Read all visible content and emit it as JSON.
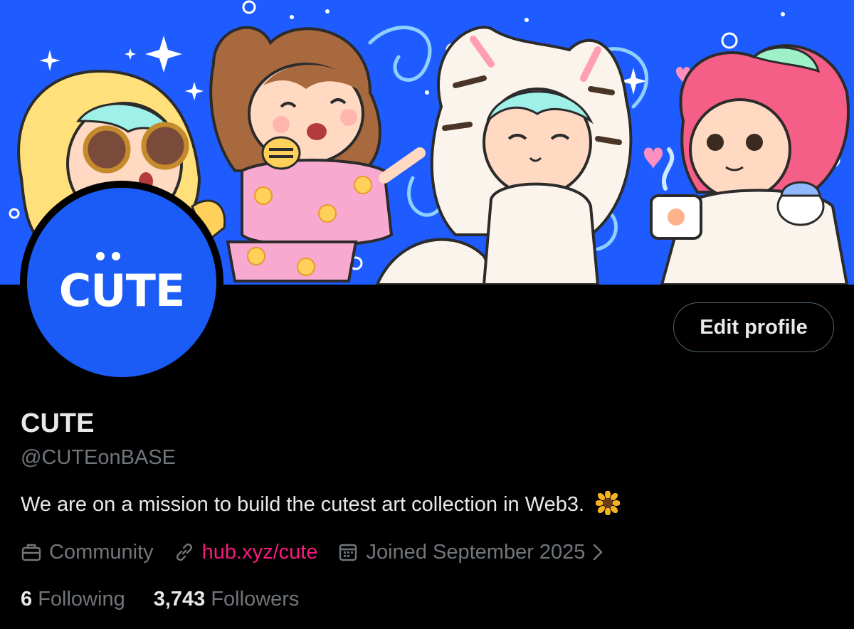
{
  "profile": {
    "display_name": "CUTE",
    "handle": "@CUTEonBASE",
    "bio": "We are on a mission to build the cutest art collection in Web3.",
    "bio_emoji": "sunflower-icon",
    "avatar_text": "CUTE",
    "category": "Community",
    "link": "hub.xyz/cute",
    "joined": "Joined September 2025",
    "following_count": "6",
    "following_label": "Following",
    "followers_count": "3,743",
    "followers_label": "Followers"
  },
  "actions": {
    "edit_profile_label": "Edit profile"
  },
  "icons": {
    "category": "briefcase-icon",
    "link": "link-icon",
    "joined": "calendar-icon",
    "joined_more": "chevron-right-icon"
  },
  "colors": {
    "banner_bg": "#1f5cff",
    "avatar_bg": "#1a5cf5",
    "link": "#f91880",
    "secondary_text": "#71767b",
    "primary_text": "#e7e9ea",
    "page_bg": "#000000"
  }
}
